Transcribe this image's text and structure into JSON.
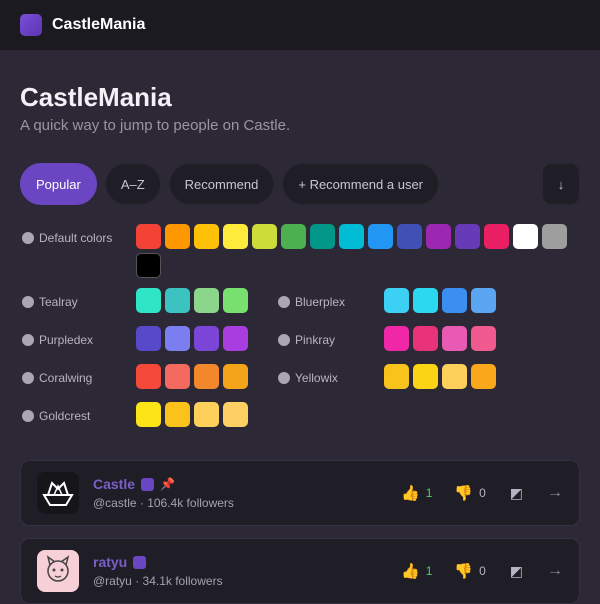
{
  "app": {
    "name": "CastleMania"
  },
  "header": {
    "title": "CastleMania",
    "subtitle": "A quick way to jump to people on Castle."
  },
  "tabs": [
    {
      "label": "Popular",
      "active": true
    },
    {
      "label": "A–Z",
      "active": false
    },
    {
      "label": "Recommend",
      "active": false
    },
    {
      "label": "+ Recommend a user",
      "active": false
    },
    {
      "label": "↓",
      "active": false
    }
  ],
  "color_groups": {
    "default": {
      "label": "Default colors",
      "colors": [
        "#f44336",
        "#ff9800",
        "#ffc107",
        "#ffeb3b",
        "#cddc39",
        "#4caf50",
        "#009688",
        "#00bcd4",
        "#2196f3",
        "#3f51b5",
        "#9c27b0",
        "#673ab7",
        "#e91e63",
        "#ffffff",
        "#9e9e9e",
        "#000000"
      ]
    },
    "tealray": {
      "label": "Tealray",
      "colors": [
        "#2ee6c5",
        "#3cc2c0",
        "#8bd68b",
        "#77e06e"
      ]
    },
    "bluerplex": {
      "label": "Bluerplex",
      "colors": [
        "#3bd0f4",
        "#2ad8f0",
        "#3b8ff0",
        "#5aa6f2"
      ]
    },
    "purpledex": {
      "label": "Purpledex",
      "colors": [
        "#5849c8",
        "#7a7ef0",
        "#7b45d8",
        "#a93ee0"
      ]
    },
    "pinkray": {
      "label": "Pinkray",
      "colors": [
        "#f028a8",
        "#e8327a",
        "#e85ab4",
        "#f05a8e"
      ]
    },
    "coralwing": {
      "label": "Coralwing",
      "colors": [
        "#f4483a",
        "#f46a5e",
        "#f4862c",
        "#f4a41a"
      ]
    },
    "yellowix": {
      "label": "Yellowix",
      "colors": [
        "#f8c31a",
        "#fcd416",
        "#fcd05a",
        "#f8a81a"
      ]
    },
    "goldcrest": {
      "label": "Goldcrest",
      "colors": [
        "#fce416",
        "#fcc21c",
        "#fcd05a",
        "#fcd062"
      ]
    }
  },
  "users": [
    {
      "name": "Castle",
      "stats": "@castle · 106.4k followers",
      "likes": "1",
      "dislikes": "0",
      "avatar": "boat-crown-icon"
    },
    {
      "name": "ratyu",
      "stats": "@ratyu · 34.1k followers",
      "likes": "1",
      "dislikes": "0",
      "avatar": "cat-doodle-icon"
    }
  ]
}
